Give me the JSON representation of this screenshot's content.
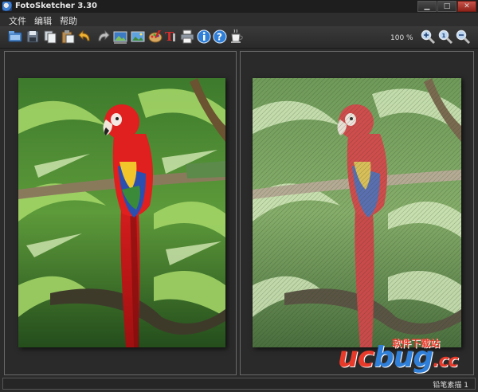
{
  "window": {
    "title": "FotoSketcher 3.30",
    "minimize_glyph": "▁",
    "maximize_glyph": "□",
    "close_glyph": "✕"
  },
  "menu": {
    "items": [
      {
        "label": "文件"
      },
      {
        "label": "编辑"
      },
      {
        "label": "帮助"
      }
    ]
  },
  "toolbar": {
    "tools": [
      {
        "icon": "open-folder-icon"
      },
      {
        "icon": "save-icon"
      },
      {
        "icon": "copy-icon"
      },
      {
        "icon": "paste-icon"
      },
      {
        "icon": "undo-icon"
      },
      {
        "icon": "redo-icon"
      },
      {
        "icon": "image-settings-icon"
      },
      {
        "icon": "image-landscape-icon"
      },
      {
        "icon": "palette-icon"
      },
      {
        "icon": "add-text-icon"
      },
      {
        "icon": "print-icon"
      },
      {
        "icon": "info-icon"
      },
      {
        "icon": "help-icon"
      },
      {
        "icon": "coffee-cup-icon"
      },
      {
        "icon": "zoom-in-icon"
      },
      {
        "icon": "zoom-reset-icon"
      },
      {
        "icon": "zoom-out-icon"
      }
    ],
    "zoom_level": "100 %"
  },
  "panels": {
    "left": {
      "label": "original-image"
    },
    "right": {
      "label": "sketch-result-image"
    }
  },
  "status": {
    "text": "铅笔素描 1"
  },
  "watermark": {
    "main_red": "uc",
    "main_blue": "bug",
    "main_tail": ".cc",
    "sub": "软件下载站"
  },
  "colors": {
    "background": "#2b2b2b",
    "panel_border": "#6a6a6a",
    "accent_blue": "#2f7fd8",
    "watermark_red": "#e83a2a"
  }
}
